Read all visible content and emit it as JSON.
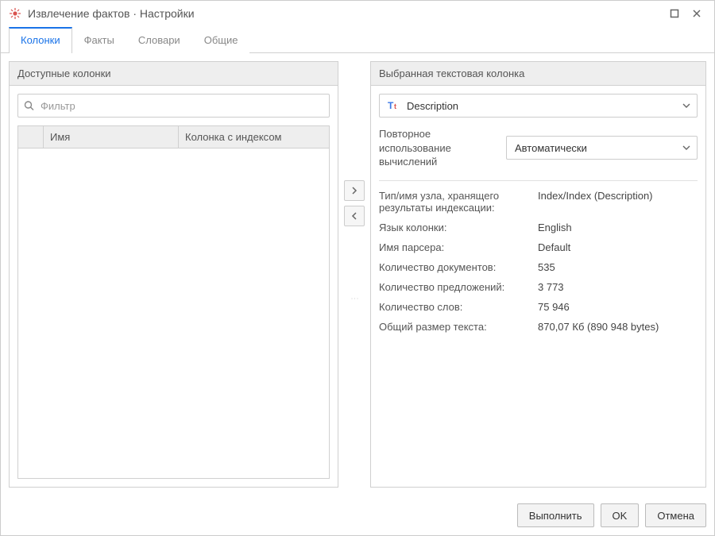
{
  "window": {
    "title": "Извлечение фактов · Настройки"
  },
  "tabs": [
    "Колонки",
    "Факты",
    "Словари",
    "Общие"
  ],
  "left": {
    "panel_title": "Доступные колонки",
    "filter_placeholder": "Фильтр",
    "columns": {
      "c0": "",
      "c1": "Имя",
      "c2": "Колонка с индексом"
    }
  },
  "right": {
    "panel_title": "Выбранная текстовая колонка",
    "column_select": "Description",
    "reuse_label": "Повторное использование вычислений",
    "reuse_value": "Автоматически",
    "info": {
      "node_label": "Тип/имя узла, хранящего результаты индексации:",
      "node_value": "Index/Index (Description)",
      "lang_label": "Язык колонки:",
      "lang_value": "English",
      "parser_label": "Имя парсера:",
      "parser_value": "Default",
      "docs_label": "Количество документов:",
      "docs_value": "535",
      "sent_label": "Количество предложений:",
      "sent_value": "3 773",
      "words_label": "Количество слов:",
      "words_value": "75 946",
      "size_label": "Общий размер текста:",
      "size_value": "870,07 Кб (890 948 bytes)"
    }
  },
  "footer": {
    "execute": "Выполнить",
    "ok": "OK",
    "cancel": "Отмена"
  }
}
